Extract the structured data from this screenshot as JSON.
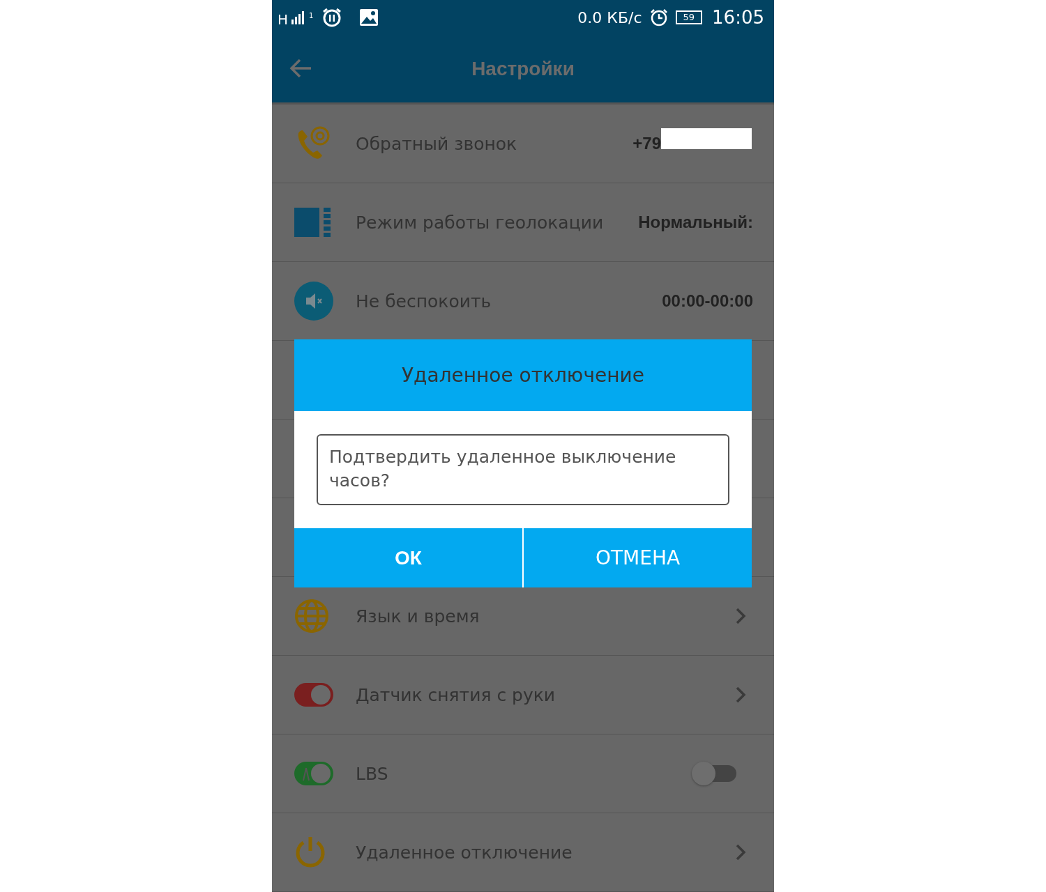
{
  "status_bar": {
    "network": "H",
    "sim": "1",
    "speed": "0.0 КБ/с",
    "battery": "59",
    "time": "16:05"
  },
  "toolbar": {
    "title": "Настройки"
  },
  "rows": [
    {
      "kind": "value",
      "label": "Обратный звонок",
      "value": "+79"
    },
    {
      "kind": "value",
      "label": "Режим работы геолокации",
      "value": "Нормальный:"
    },
    {
      "kind": "value",
      "label": "Не беспокоить",
      "value": "00:00-00:00"
    },
    {
      "kind": "hidden"
    },
    {
      "kind": "hidden"
    },
    {
      "kind": "hidden"
    },
    {
      "kind": "chevron",
      "label": "Язык и время"
    },
    {
      "kind": "chevron",
      "label": "Датчик снятия с руки"
    },
    {
      "kind": "switch",
      "label": "LBS",
      "on": false
    },
    {
      "kind": "chevron",
      "label": "Удаленное отключение"
    }
  ],
  "dialog": {
    "title": "Удаленное отключение",
    "message": "Подтвердить удаленное выключение часов?",
    "buttons": [
      {
        "label": "ОК",
        "kind": "primary"
      },
      {
        "label": "ОТМЕНА",
        "kind": "secondary"
      }
    ]
  }
}
